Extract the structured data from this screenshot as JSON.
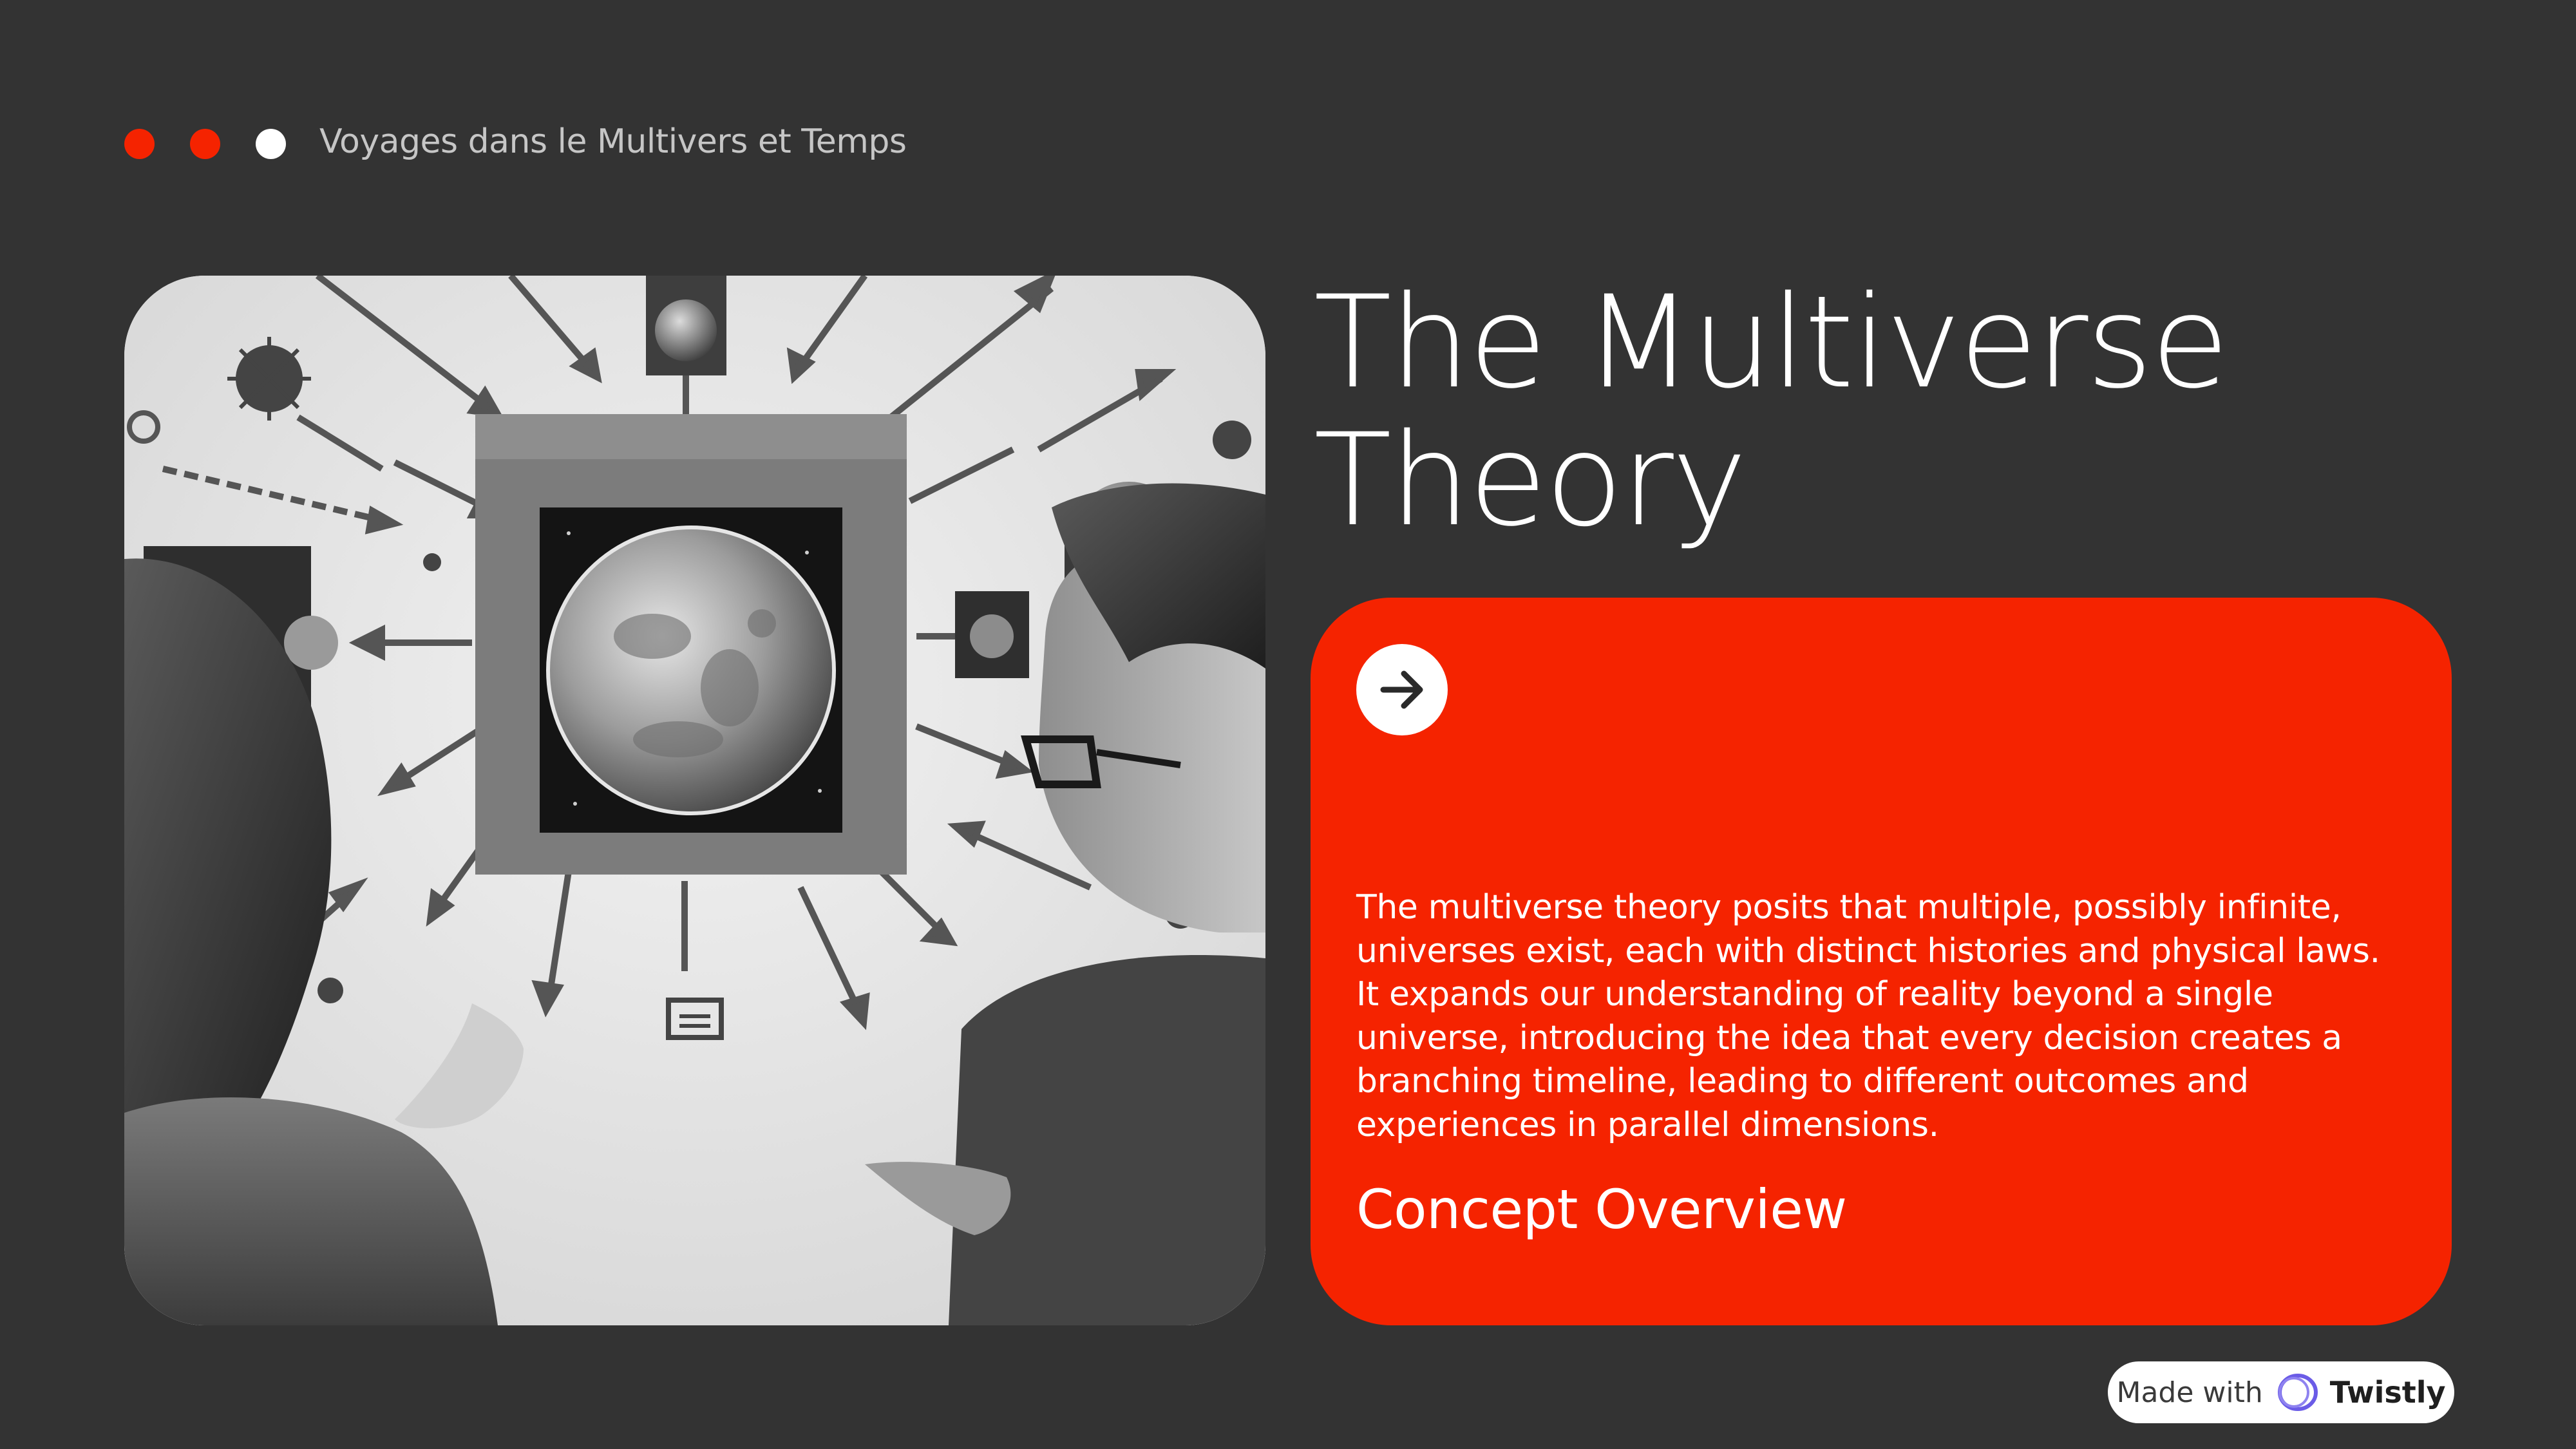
{
  "header": {
    "breadcrumb": "Voyages dans le Multivers et Temps",
    "dot_colors": [
      "#f52300",
      "#f52300",
      "#ffffff"
    ]
  },
  "slide": {
    "title_line1": "The Multiverse",
    "title_line2": "Theory",
    "card": {
      "background": "#f52300",
      "button_icon": "arrow-right-icon",
      "body": "The multiverse theory posits that multiple, possibly infinite, universes exist, each with distinct histories and physical laws. It expands our understanding of reality beyond a single universe, introducing the idea that every decision creates a branching timeline, leading to different outcomes and experiences in parallel dimensions.",
      "subtitle": "Concept Overview"
    },
    "illustration_icon": "multiverse-illustration"
  },
  "badge": {
    "made_with": "Made with",
    "brand": "Twistly",
    "logo_icon": "twistly-logo-icon"
  }
}
